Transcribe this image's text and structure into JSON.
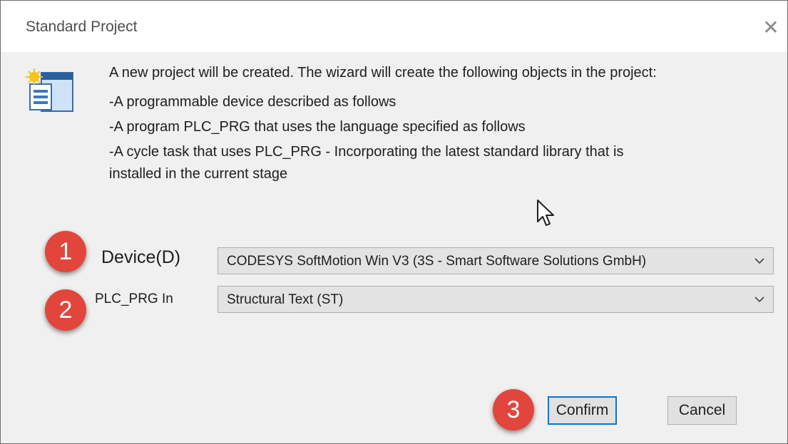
{
  "dialog": {
    "title": "Standard Project",
    "close_glyph": "✕"
  },
  "description": {
    "intro": "A new project will be created. The wizard will create the following objects in the project:",
    "lines": [
      "-A programmable device described as follows",
      "-A program PLC_PRG that uses the language specified as follows",
      "-A cycle task that uses PLC_PRG - Incorporating the latest standard library that is",
      "installed in the current stage"
    ]
  },
  "fields": {
    "device": {
      "label": "Device(D)",
      "value": "CODESYS SoftMotion Win V3 (3S - Smart Software Solutions GmbH)"
    },
    "plc_prg": {
      "label": "PLC_PRG In",
      "value": "Structural Text (ST)"
    }
  },
  "buttons": {
    "confirm": "Confirm",
    "cancel": "Cancel"
  },
  "annotations": [
    "1",
    "2",
    "3"
  ],
  "icons": {
    "project": "new-project-icon",
    "cursor": "mouse-pointer-icon",
    "dropdown": "chevron-down-icon"
  },
  "colors": {
    "badge": "#e2453c",
    "default_button_border": "#0078d7",
    "dialog_bg": "#f0f0f0"
  }
}
